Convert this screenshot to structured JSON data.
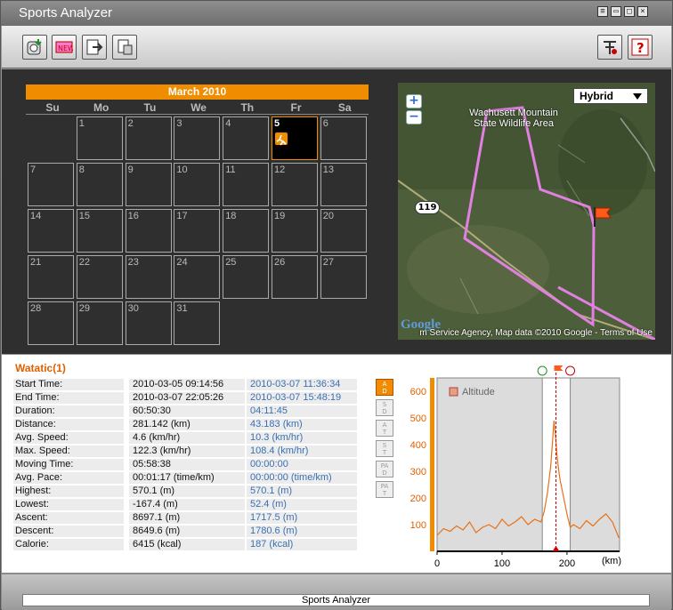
{
  "window": {
    "title": "Sports Analyzer"
  },
  "calendar": {
    "month_label": "March 2010",
    "weekdays": [
      "Su",
      "Mo",
      "Tu",
      "We",
      "Th",
      "Fr",
      "Sa"
    ],
    "days": [
      "1",
      "2",
      "3",
      "4",
      "5",
      "6",
      "7",
      "8",
      "9",
      "10",
      "11",
      "12",
      "13",
      "14",
      "15",
      "16",
      "17",
      "18",
      "19",
      "20",
      "21",
      "22",
      "23",
      "24",
      "25",
      "26",
      "27",
      "28",
      "29",
      "30",
      "31"
    ],
    "selected_day": "5"
  },
  "map": {
    "type_selector": "Hybrid",
    "zoom_in": "+",
    "zoom_out": "−",
    "label_area": "Wachusett Mountain\nState Wildlife Area",
    "route_shield": "119",
    "attribution": "m Service Agency, Map data ©2010 Google - Terms of Use",
    "logo": "Google"
  },
  "track": {
    "name": "Watatic(1)",
    "rows": [
      {
        "label": "Start Time:",
        "v1": "2010-03-05 09:14:56",
        "v2": "2010-03-07 11:36:34"
      },
      {
        "label": "End Time:",
        "v1": "2010-03-07 22:05:26",
        "v2": "2010-03-07 15:48:19"
      },
      {
        "label": "Duration:",
        "v1": "60:50:30",
        "v2": "04:11:45"
      },
      {
        "label": "Distance:",
        "v1": "281.142 (km)",
        "v2": "43.183 (km)"
      },
      {
        "label": "Avg. Speed:",
        "v1": "4.6 (km/hr)",
        "v2": "10.3 (km/hr)"
      },
      {
        "label": "Max. Speed:",
        "v1": "122.3 (km/hr)",
        "v2": "108.4 (km/hr)"
      },
      {
        "label": "Moving Time:",
        "v1": "05:58:38",
        "v2": "00:00:00"
      },
      {
        "label": "Avg. Pace:",
        "v1": "00:01:17 (time/km)",
        "v2": "00:00:00 (time/km)"
      },
      {
        "label": "Highest:",
        "v1": "570.1 (m)",
        "v2": "570.1 (m)"
      },
      {
        "label": "Lowest:",
        "v1": "-167.4 (m)",
        "v2": "52.4 (m)"
      },
      {
        "label": "Ascent:",
        "v1": "8697.1 (m)",
        "v2": "1717.5 (m)"
      },
      {
        "label": "Descent:",
        "v1": "8649.6 (m)",
        "v2": "1780.6 (m)"
      },
      {
        "label": "Calorie:",
        "v1": "6415 (kcal)",
        "v2": "187 (kcal)"
      }
    ]
  },
  "side_buttons": [
    {
      "top": "A",
      "bottom": "D",
      "active": true
    },
    {
      "top": "S",
      "bottom": "D",
      "active": false
    },
    {
      "top": "A",
      "bottom": "T",
      "active": false
    },
    {
      "top": "S",
      "bottom": "T",
      "active": false
    },
    {
      "top": "PA",
      "bottom": "D",
      "active": false
    },
    {
      "top": "PA",
      "bottom": "T",
      "active": false
    }
  ],
  "chart_data": {
    "type": "line",
    "legend": "Altitude",
    "xlabel": "(km)",
    "x_ticks": [
      "0",
      "100",
      "200"
    ],
    "y_ticks": [
      "100",
      "200",
      "300",
      "400",
      "500",
      "600"
    ],
    "xlim": [
      0,
      281
    ],
    "ylim": [
      0,
      650
    ],
    "selection_range_km": [
      162,
      205
    ],
    "marker_km": 183,
    "series": [
      {
        "name": "Altitude",
        "x": [
          0,
          10,
          20,
          30,
          40,
          50,
          60,
          70,
          80,
          90,
          100,
          110,
          120,
          130,
          140,
          150,
          160,
          165,
          170,
          175,
          178,
          180,
          182,
          185,
          188,
          190,
          195,
          200,
          205,
          210,
          220,
          230,
          240,
          250,
          260,
          270,
          280
        ],
        "y": [
          60,
          85,
          75,
          95,
          80,
          110,
          70,
          90,
          100,
          85,
          120,
          95,
          110,
          130,
          100,
          120,
          110,
          150,
          220,
          320,
          420,
          490,
          440,
          350,
          290,
          260,
          200,
          140,
          90,
          100,
          85,
          115,
          95,
          120,
          140,
          110,
          50
        ]
      }
    ]
  },
  "status": {
    "text": "Sports Analyzer"
  }
}
